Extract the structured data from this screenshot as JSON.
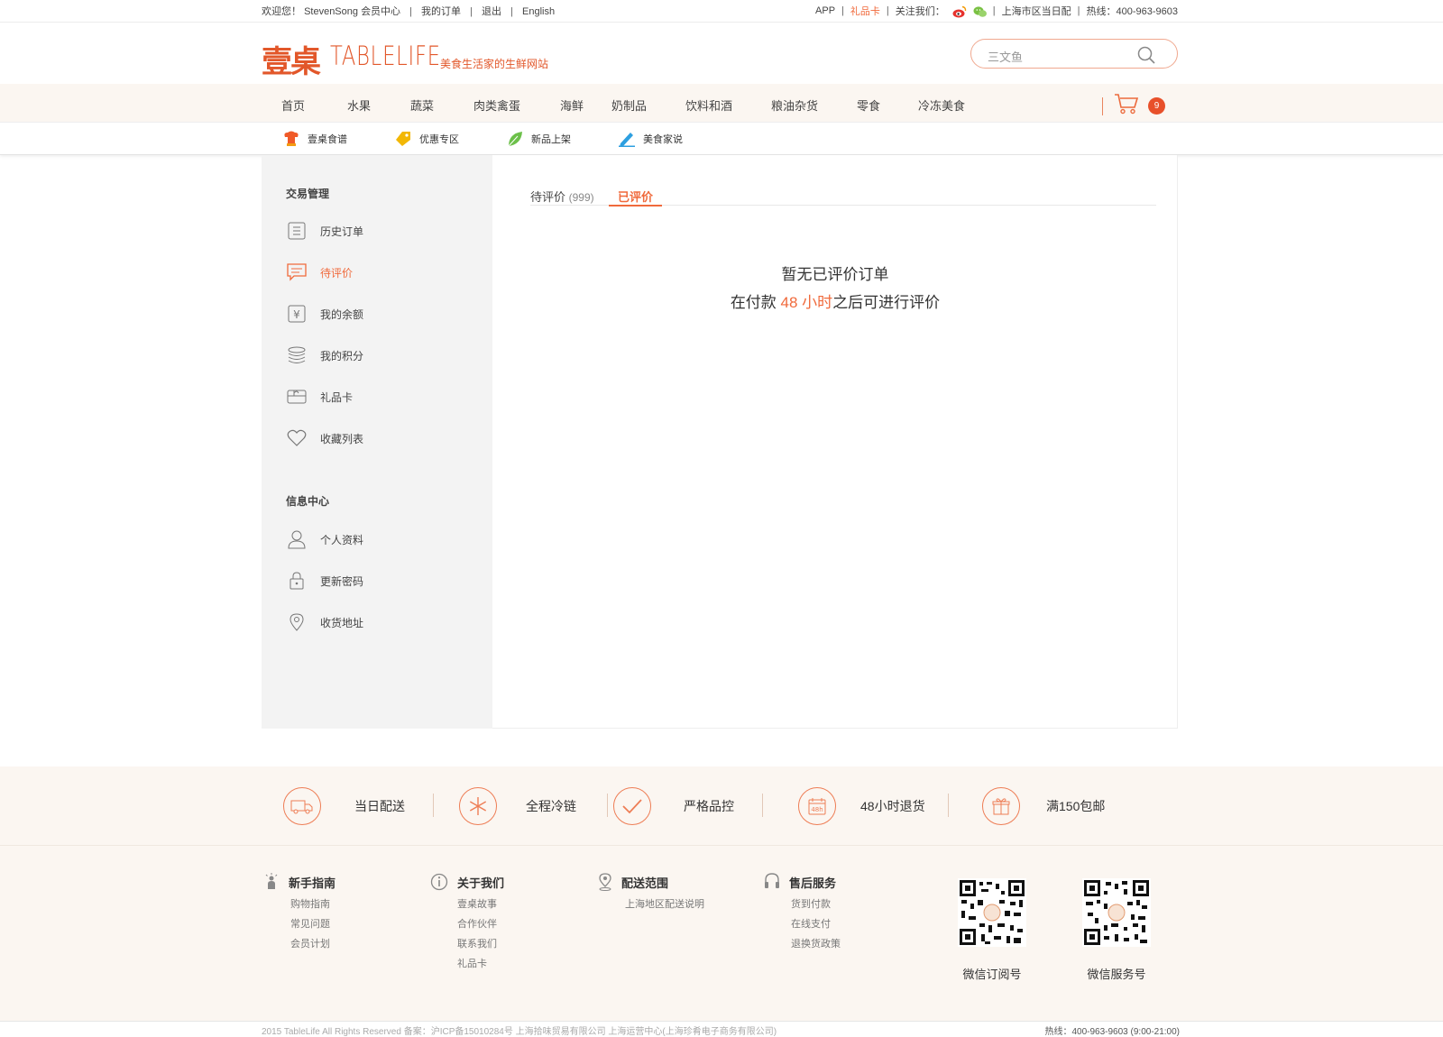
{
  "topbar": {
    "welcome": "欢迎您！",
    "user": "StevenSong",
    "member": "会员中心",
    "orders": "我的订单",
    "logout": "退出",
    "lang": "English",
    "app": "APP",
    "giftcard": "礼品卡",
    "follow": "关注我们：",
    "delivery": "上海市区当日配",
    "hotline": "热线：400-963-9603"
  },
  "header": {
    "logo_cn": "壹桌",
    "logo_en": "TABLELIFE",
    "slogan": "美食生活家的生鲜网站",
    "search_placeholder": "三文鱼"
  },
  "nav": {
    "items": [
      "首页",
      "水果",
      "蔬菜",
      "肉类禽蛋",
      "海鲜",
      "奶制品",
      "饮料和酒",
      "粮油杂货",
      "零食",
      "冷冻美食"
    ],
    "cart_count": "9"
  },
  "subnav": {
    "items": [
      {
        "label": "壹桌食谱",
        "icon": "chef-hat-icon"
      },
      {
        "label": "优惠专区",
        "icon": "tag-icon"
      },
      {
        "label": "新品上架",
        "icon": "leaf-icon"
      },
      {
        "label": "美食家说",
        "icon": "pen-icon"
      }
    ]
  },
  "sidebar": {
    "section1": "交易管理",
    "items1": [
      "历史订单",
      "待评价",
      "我的余额",
      "我的积分",
      "礼品卡",
      "收藏列表"
    ],
    "section2": "信息中心",
    "items2": [
      "个人资料",
      "更新密码",
      "收货地址"
    ]
  },
  "content": {
    "tab_pending": "待评价",
    "tab_pending_count": "(999)",
    "tab_done": "已评价",
    "empty_title": "暂无已评价订单",
    "empty_pre": "在付款",
    "empty_hl": "48 小时",
    "empty_post": "之后可进行评价"
  },
  "features": [
    "当日配送",
    "全程冷链",
    "严格品控",
    "48小时退货",
    "满150包邮"
  ],
  "footer": {
    "cols": [
      {
        "head": "新手指南",
        "links": [
          "购物指南",
          "常见问题",
          "会员计划"
        ]
      },
      {
        "head": "关于我们",
        "links": [
          "壹桌故事",
          "合作伙伴",
          "联系我们",
          "礼品卡"
        ]
      },
      {
        "head": "配送范围",
        "links": [
          "上海地区配送说明"
        ]
      },
      {
        "head": "售后服务",
        "links": [
          "货到付款",
          "在线支付",
          "退换货政策"
        ]
      }
    ],
    "qr1": "微信订阅号",
    "qr2": "微信服务号",
    "copyright": "2015 TableLife All Rights Reserved 备案：沪ICP备15010284号 上海拾味贸易有限公司 上海运营中心(上海珍肴电子商务有限公司)",
    "hotline": "热线：400-963-9603 (9:00-21:00)"
  },
  "colors": {
    "accent": "#f06a3c",
    "nav_bg": "#fbf6f1",
    "sidebar_bg": "#f3f3f3"
  }
}
